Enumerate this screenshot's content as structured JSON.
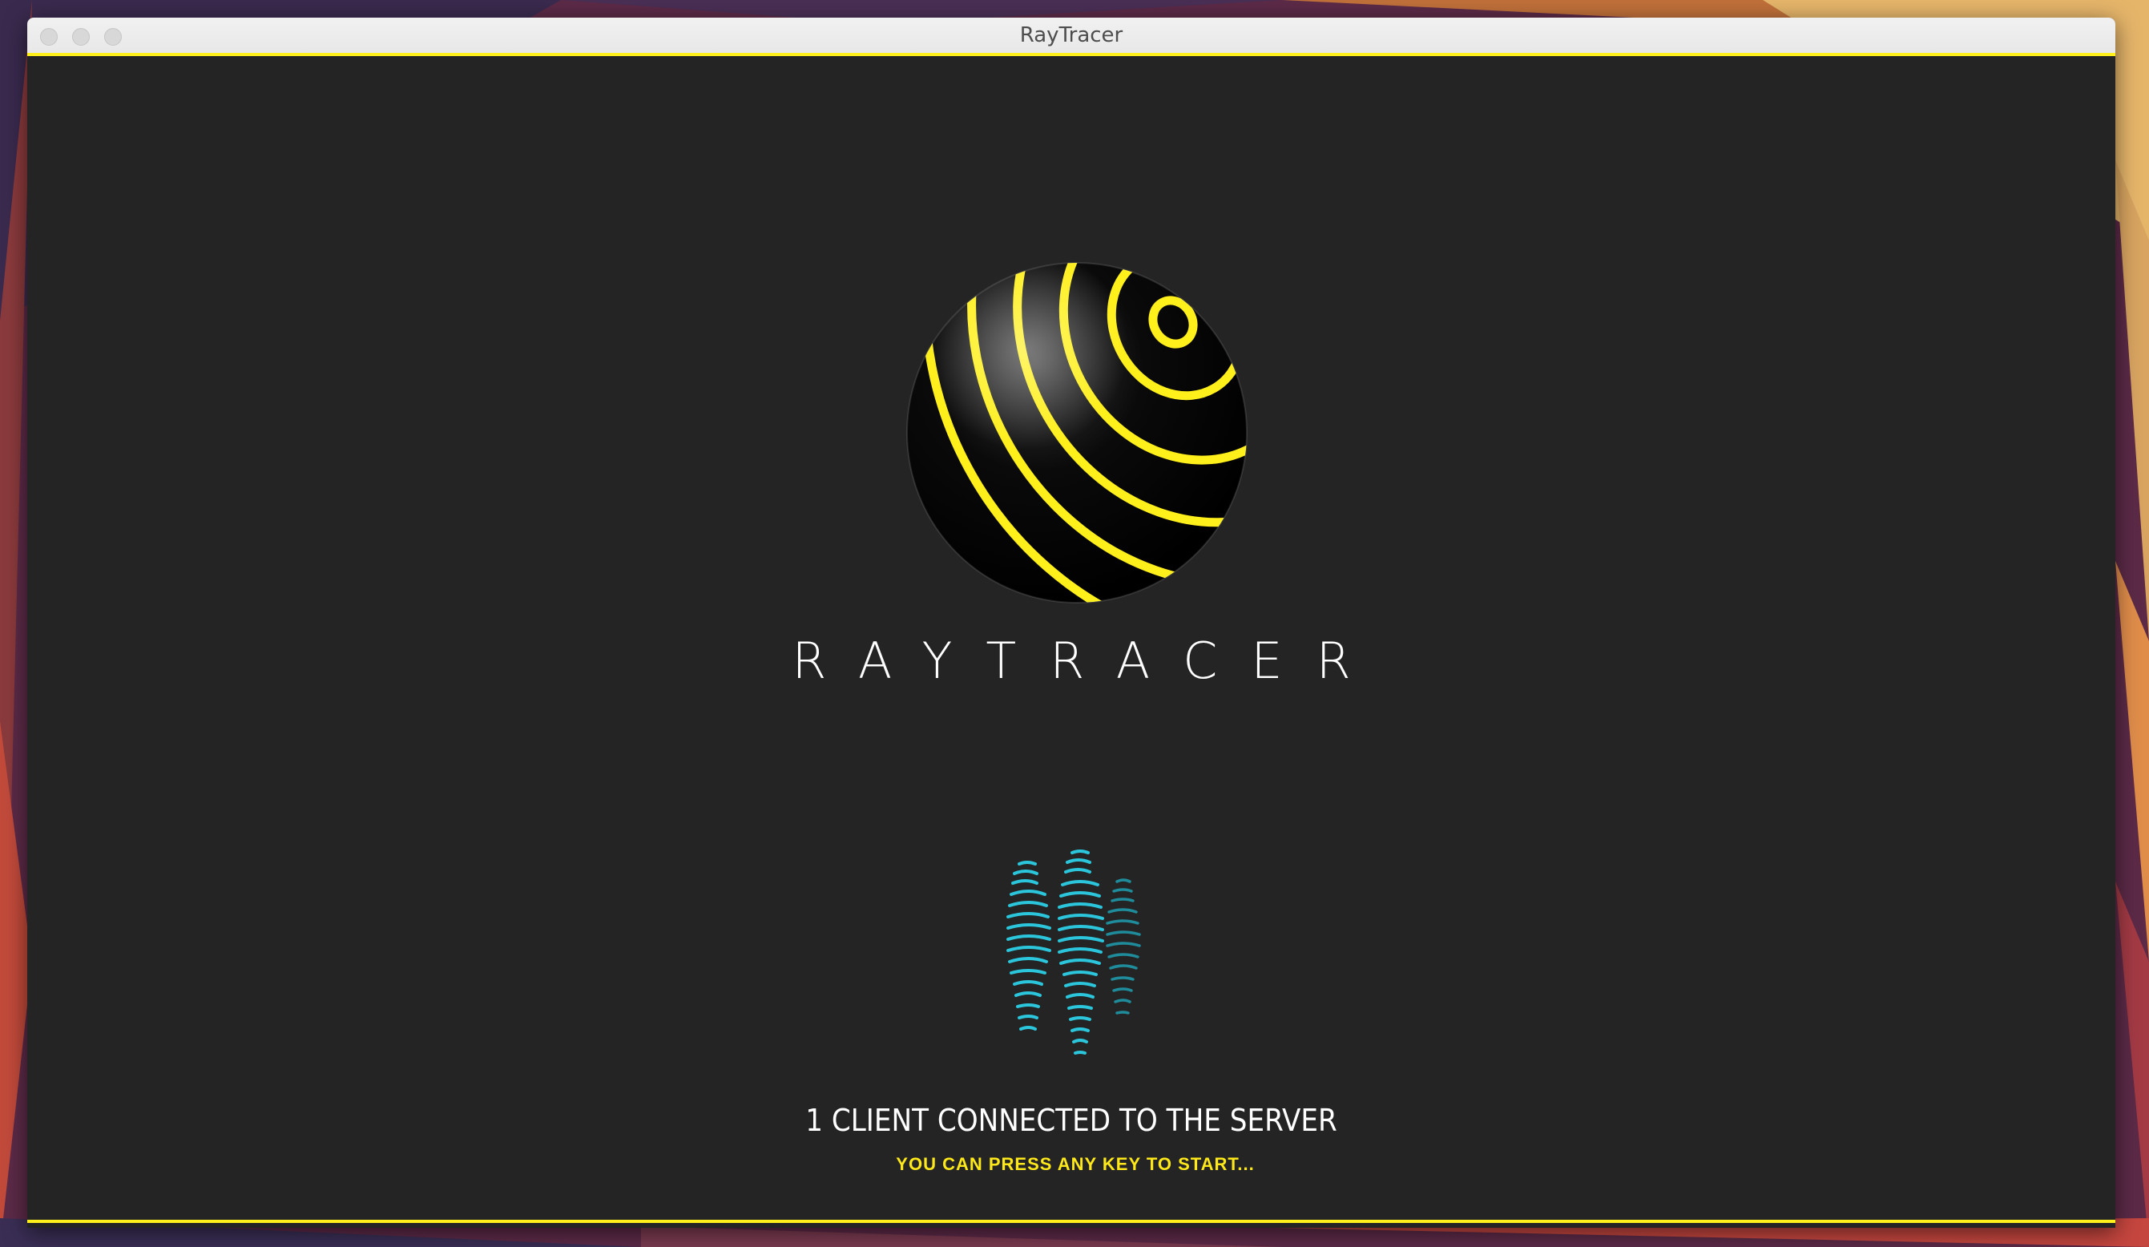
{
  "window": {
    "title": "RayTracer"
  },
  "splash": {
    "brand": "RAYTRACER",
    "logo_icon": "striped-sphere-logo",
    "clients_icon": "people-icon"
  },
  "status": {
    "connected": "1 CLIENT CONNECTED TO THE SERVER",
    "hint": "YOU CAN PRESS ANY KEY TO START..."
  },
  "colors": {
    "accent": "#ffef1a",
    "background": "#242424",
    "icon_cyan": "#2bc6dc"
  }
}
